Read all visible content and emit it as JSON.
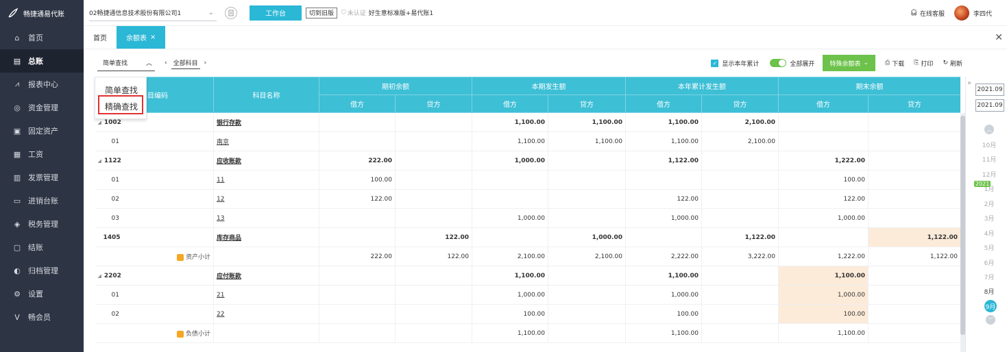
{
  "app": {
    "logo_text": "畅捷通易代账"
  },
  "topbar": {
    "company": "02畅捷通信息技术股份有限公司1",
    "workbench": "工作台",
    "old_version": "切到旧版",
    "cert_status": "未认证",
    "edition": "好生意标准版+易代账1",
    "support": "在线客服",
    "user": "李四代"
  },
  "sidebar": {
    "items": [
      {
        "label": "首页",
        "icon": "home-icon"
      },
      {
        "label": "总账",
        "icon": "ledger-icon",
        "active": true
      },
      {
        "label": "报表中心",
        "icon": "report-chart-icon"
      },
      {
        "label": "资金管理",
        "icon": "money-bag-icon"
      },
      {
        "label": "固定资产",
        "icon": "fixed-asset-icon"
      },
      {
        "label": "工资",
        "icon": "payroll-icon"
      },
      {
        "label": "发票管理",
        "icon": "invoice-icon"
      },
      {
        "label": "进销台账",
        "icon": "trade-ledger-icon"
      },
      {
        "label": "税务管理",
        "icon": "tax-icon"
      },
      {
        "label": "结账",
        "icon": "close-account-icon"
      },
      {
        "label": "归档管理",
        "icon": "archive-icon"
      },
      {
        "label": "设置",
        "icon": "gear-icon"
      },
      {
        "label": "畅会员",
        "icon": "vip-icon"
      }
    ]
  },
  "tabs": {
    "home": "首页",
    "balance": "余额表",
    "close": "×"
  },
  "toolbar": {
    "search_mode": "简单查找",
    "subject": "全部科目",
    "show_year": "显示本年累计",
    "expand_all": "全部展开",
    "special": "特殊余额表",
    "download": "下载",
    "print": "打印",
    "refresh": "刷新"
  },
  "dropdown": {
    "simple": "简单查找",
    "exact": "精确查找"
  },
  "table": {
    "headers": {
      "code": "科目编码",
      "name": "科目名称",
      "opening": "期初余额",
      "current": "本期发生额",
      "ytd": "本年累计发生额",
      "closing": "期末余额",
      "debit": "借方",
      "credit": "贷方"
    },
    "rows": [
      {
        "code": "1002",
        "name": "银行存款",
        "cells": [
          "",
          "",
          "1,100.00",
          "1,100.00",
          "1,100.00",
          "2,100.00",
          "",
          ""
        ]
      },
      {
        "code": "01",
        "name": "南京",
        "cells": [
          "",
          "",
          "1,100.00",
          "1,100.00",
          "1,100.00",
          "2,100.00",
          "",
          ""
        ]
      },
      {
        "code": "1122",
        "name": "应收账款",
        "cells": [
          "222.00",
          "",
          "1,000.00",
          "",
          "1,122.00",
          "",
          "1,222.00",
          ""
        ]
      },
      {
        "code": "01",
        "name": "11",
        "cells": [
          "100.00",
          "",
          "",
          "",
          "",
          "",
          "100.00",
          ""
        ]
      },
      {
        "code": "02",
        "name": "12",
        "cells": [
          "122.00",
          "",
          "",
          "",
          "122.00",
          "",
          "122.00",
          ""
        ]
      },
      {
        "code": "03",
        "name": "13",
        "cells": [
          "",
          "",
          "1,000.00",
          "",
          "1,000.00",
          "",
          "1,000.00",
          ""
        ]
      },
      {
        "code": "1405",
        "name": "库存商品",
        "cells": [
          "",
          "122.00",
          "",
          "1,000.00",
          "",
          "1,122.00",
          "",
          "1,122.00"
        ]
      },
      {
        "code": "",
        "name": "资产小计",
        "cells": [
          "222.00",
          "122.00",
          "2,100.00",
          "2,100.00",
          "2,222.00",
          "3,222.00",
          "1,222.00",
          "1,122.00"
        ]
      },
      {
        "code": "2202",
        "name": "应付账款",
        "cells": [
          "",
          "",
          "1,100.00",
          "",
          "1,100.00",
          "",
          "1,100.00",
          ""
        ]
      },
      {
        "code": "01",
        "name": "21",
        "cells": [
          "",
          "",
          "1,000.00",
          "",
          "1,000.00",
          "",
          "1,000.00",
          ""
        ]
      },
      {
        "code": "02",
        "name": "22",
        "cells": [
          "",
          "",
          "100.00",
          "",
          "100.00",
          "",
          "100.00",
          ""
        ]
      },
      {
        "code": "",
        "name": "负债小计",
        "cells": [
          "",
          "",
          "1,100.00",
          "",
          "1,100.00",
          "",
          "1,100.00",
          ""
        ]
      }
    ]
  },
  "period": {
    "from": "2021.09",
    "to": "2021.09",
    "year": "2021",
    "months": [
      "10月",
      "11月",
      "12月",
      "1月",
      "2月",
      "3月",
      "4月",
      "5月",
      "6月",
      "7月",
      "8月",
      "9月"
    ],
    "current": "9月"
  }
}
